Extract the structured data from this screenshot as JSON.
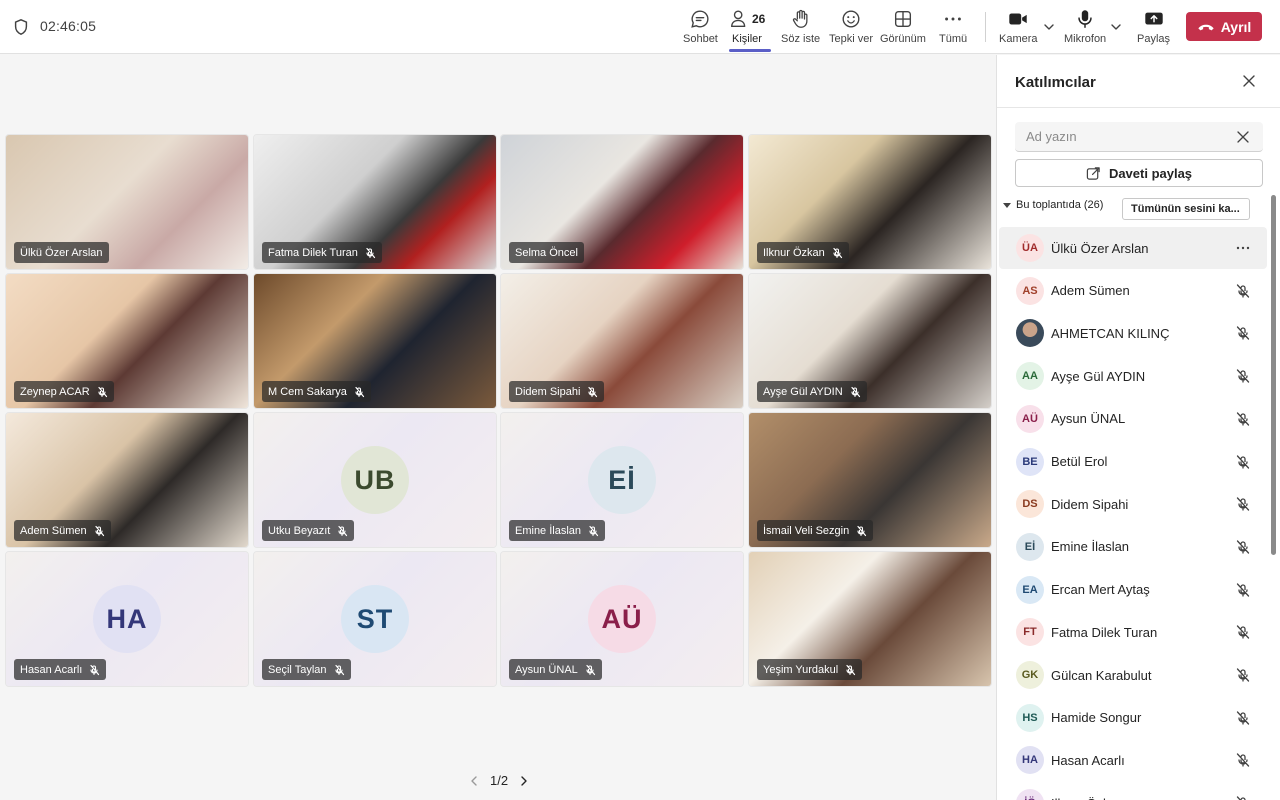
{
  "topbar": {
    "timer": "02:46:05",
    "people_count": "26",
    "buttons": {
      "chat": "Sohbet",
      "people": "Kişiler",
      "raise": "Söz iste",
      "react": "Tepki ver",
      "view": "Görünüm",
      "more": "Tümü",
      "camera": "Kamera",
      "mic": "Mikrofon",
      "share": "Paylaş",
      "leave": "Ayrıl"
    },
    "leave_color": "#c4314b",
    "active_underline_color": "#5b5fc7"
  },
  "stage": {
    "pager": "1/2",
    "tiles": [
      {
        "name": "Ülkü Özer Arslan",
        "video": true,
        "muted": false
      },
      {
        "name": "Fatma Dilek Turan",
        "video": true,
        "muted": true
      },
      {
        "name": "Selma Öncel",
        "video": true,
        "muted": false
      },
      {
        "name": "Ilknur Özkan",
        "video": true,
        "muted": true
      },
      {
        "name": "Zeynep ACAR",
        "video": true,
        "muted": true
      },
      {
        "name": "M Cem Sakarya",
        "video": true,
        "muted": true
      },
      {
        "name": "Didem Sipahi",
        "video": true,
        "muted": true
      },
      {
        "name": "Ayşe Gül AYDIN",
        "video": true,
        "muted": true
      },
      {
        "name": "Adem Sümen",
        "video": true,
        "muted": true
      },
      {
        "name": "Utku Beyazıt",
        "video": false,
        "initials": "UB",
        "muted": true
      },
      {
        "name": "Emine İlaslan",
        "video": false,
        "initials": "Eİ",
        "muted": true
      },
      {
        "name": "İsmail Veli Sezgin",
        "video": true,
        "muted": true
      },
      {
        "name": "Hasan Acarlı",
        "video": false,
        "initials": "HA",
        "muted": true
      },
      {
        "name": "Seçil Taylan",
        "video": false,
        "initials": "ST",
        "muted": true
      },
      {
        "name": "Aysun ÜNAL",
        "video": false,
        "initials": "AÜ",
        "muted": true
      },
      {
        "name": "Yeşim Yurdakul",
        "video": true,
        "muted": true
      }
    ]
  },
  "panel": {
    "title": "Katılımcılar",
    "search_placeholder": "Ad yazın",
    "invite_label": "Daveti paylaş",
    "section_label": "Bu toplantıda (26)",
    "mute_all_label": "Tümünün sesini ka...",
    "participants": [
      {
        "initials": "ÜA",
        "name": "Ülkü Özer Arslan",
        "highlight": true,
        "action": "more"
      },
      {
        "initials": "AS",
        "name": "Adem Sümen",
        "action": "mic-off"
      },
      {
        "initials": "",
        "name": "AHMETCAN KILINÇ",
        "photo": true,
        "action": "mic-off"
      },
      {
        "initials": "AA",
        "name": "Ayşe Gül AYDIN",
        "action": "mic-off"
      },
      {
        "initials": "AÜ",
        "name": "Aysun ÜNAL",
        "action": "mic-off"
      },
      {
        "initials": "BE",
        "name": "Betül Erol",
        "action": "mic-off"
      },
      {
        "initials": "DS",
        "name": "Didem Sipahi",
        "action": "mic-off"
      },
      {
        "initials": "Eİ",
        "name": "Emine İlaslan",
        "action": "mic-off"
      },
      {
        "initials": "EA",
        "name": "Ercan Mert Aytaş",
        "action": "mic-off"
      },
      {
        "initials": "FT",
        "name": "Fatma Dilek Turan",
        "action": "mic-off"
      },
      {
        "initials": "GK",
        "name": "Gülcan Karabulut",
        "action": "mic-off"
      },
      {
        "initials": "HS",
        "name": "Hamide Songur",
        "action": "mic-off"
      },
      {
        "initials": "HA",
        "name": "Hasan Acarlı",
        "action": "mic-off"
      },
      {
        "initials": "İÖ",
        "name": "Ilknur Özkan",
        "action": "mic-off"
      }
    ]
  }
}
